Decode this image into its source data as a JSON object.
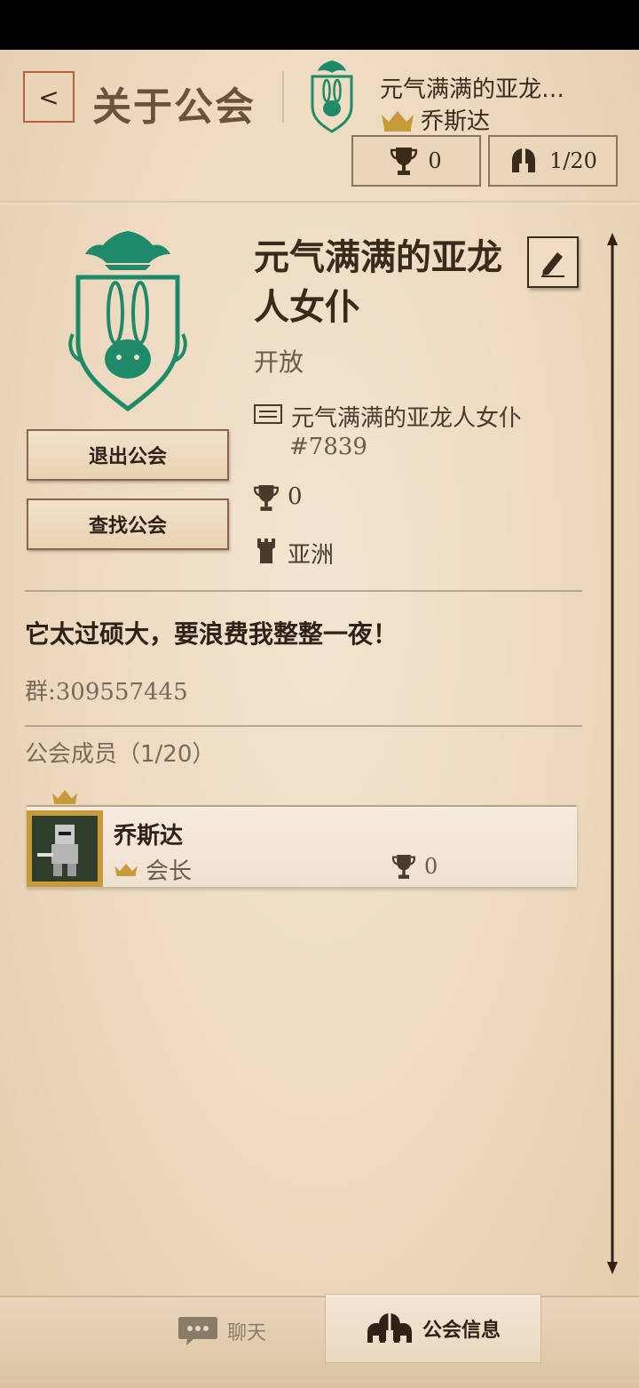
{
  "header": {
    "back_label": "<",
    "title": "关于公会",
    "guild_name": "元气满满的亚龙…",
    "leader_name": "乔斯达",
    "trophies": "0",
    "members": "1/20"
  },
  "guild": {
    "name": "元气满满的亚龙人女仆",
    "status": "开放",
    "full_name": "元气满满的亚龙人女仆",
    "tag": "#7839",
    "trophies": "0",
    "region": "亚洲",
    "motto": "它太过硕大，要浪费我整整一夜！",
    "group_id": "群:309557445"
  },
  "actions": {
    "leave": "退出公会",
    "find": "查找公会"
  },
  "members_section": {
    "heading": "公会成员（1/20）",
    "members": [
      {
        "name": "乔斯达",
        "role": "会长",
        "trophies": "0"
      }
    ]
  },
  "tabs": {
    "chat": "聊天",
    "info": "公会信息"
  },
  "colors": {
    "emblem_green": "#1f8a6a",
    "accent_gold": "#c99a3a",
    "back_border": "#b7633a"
  }
}
